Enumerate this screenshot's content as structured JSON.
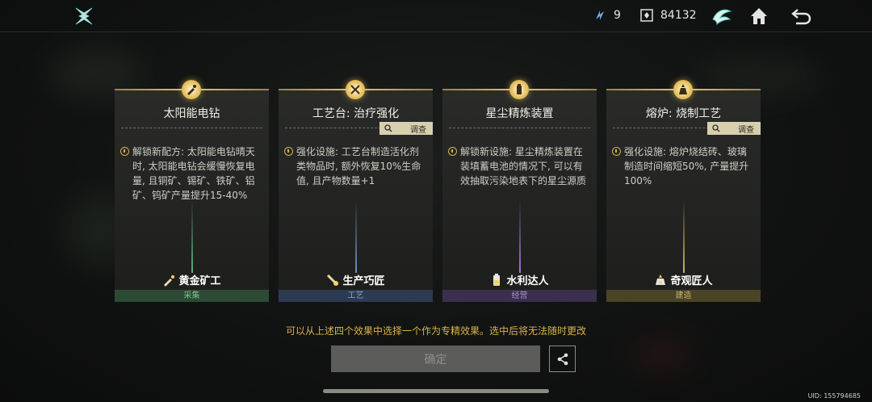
{
  "topbar": {
    "resource1_value": "9",
    "resource2_value": "84132"
  },
  "cards": [
    {
      "title": "太阳能电钻",
      "has_investigate": false,
      "desc": "解锁新配方: 太阳能电钻晴天时, 太阳能电钻会缓慢恢复电量, 且铜矿、锡矿、铁矿、铝矿、钨矿产量提升15-40%",
      "role": "黄金矿工",
      "category": "采集",
      "beam_color": "#3f7a52",
      "cat_color": "#2d4a35",
      "cat_text_color": "#7fbf8c"
    },
    {
      "title": "工艺台: 治疗强化",
      "has_investigate": true,
      "desc": "强化设施: 工艺台制造活化剂类物品时, 额外恢复10%生命值, 且产物数量+1",
      "role": "生产巧匠",
      "category": "工艺",
      "beam_color": "#3f5f8a",
      "cat_color": "#2c3a52",
      "cat_text_color": "#8aa4cc"
    },
    {
      "title": "星尘精炼装置",
      "has_investigate": false,
      "desc": "解锁新设施: 星尘精炼装置在装填蓄电池的情况下, 可以有效抽取污染地表下的星尘源质",
      "role": "水利达人",
      "category": "经营",
      "beam_color": "#6a4f8c",
      "cat_color": "#3a2f4f",
      "cat_text_color": "#a890c8"
    },
    {
      "title": "熔炉: 烧制工艺",
      "has_investigate": true,
      "desc": "强化设施: 熔炉烧结砖、玻璃制造时间缩短50%, 产量提升100%",
      "role": "奇观匠人",
      "category": "建造",
      "beam_color": "#8a7a3a",
      "cat_color": "#4a4426",
      "cat_text_color": "#c9b56a"
    }
  ],
  "investigate_label": "调查",
  "hint": "可以从上述四个效果中选择一个作为专精效果。选中后将无法随时更改",
  "confirm_label": "确定",
  "uid": "UID: 155794685",
  "icons": [
    "app-logo-icon",
    "energy-icon",
    "currency-icon",
    "wing-emblem-icon",
    "home-icon",
    "back-icon",
    "share-icon"
  ]
}
